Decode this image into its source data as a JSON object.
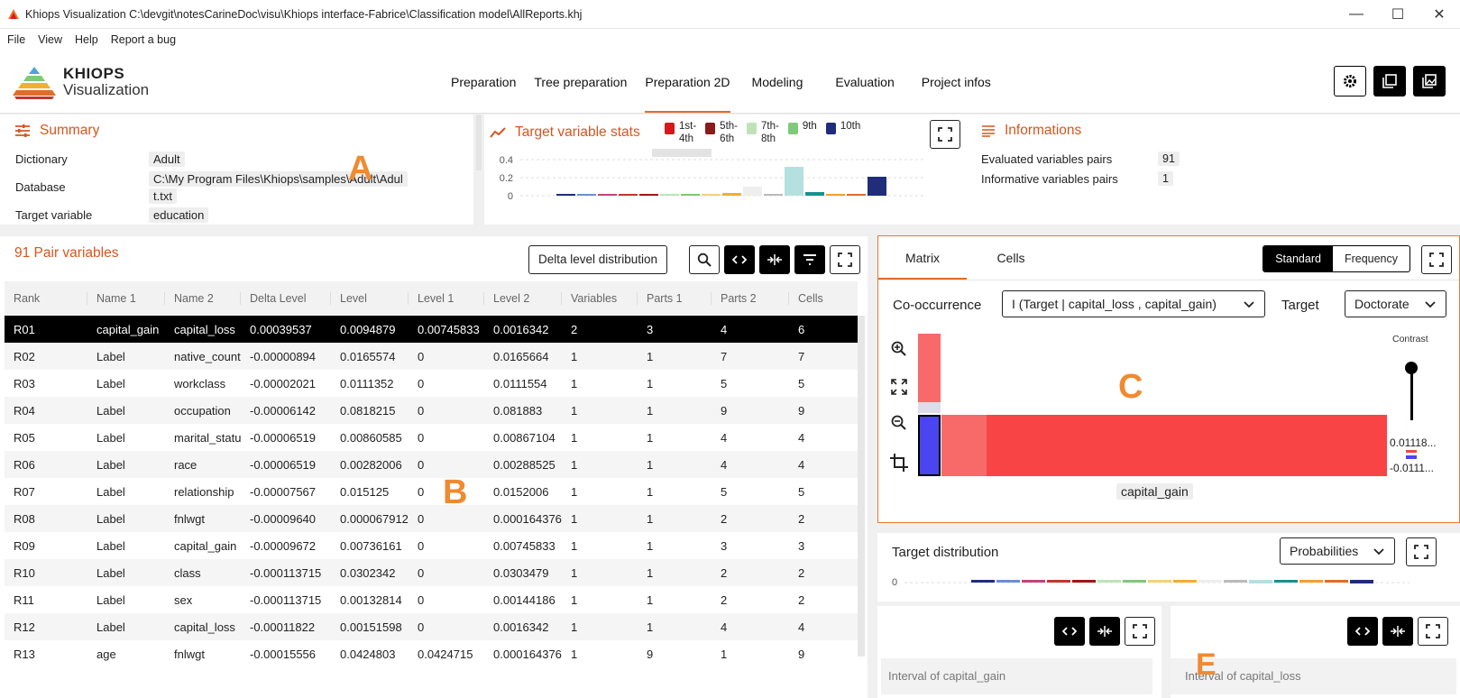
{
  "window": {
    "title": "Khiops Visualization C:\\devgit\\notesCarineDoc\\visu\\Khiops interface-Fabrice\\Classification model\\AllReports.khj",
    "minimize": "—",
    "maximize": "☐",
    "close": "✕"
  },
  "menu": {
    "file": "File",
    "view": "View",
    "help": "Help",
    "report_bug": "Report a bug"
  },
  "logo": {
    "line1": "KHIOPS",
    "line2": "Visualization"
  },
  "nav": [
    "Preparation",
    "Tree preparation",
    "Preparation 2D",
    "Modeling",
    "Evaluation",
    "Project infos"
  ],
  "nav_active": "Preparation 2D",
  "summary": {
    "title": "Summary",
    "rows": [
      {
        "label": "Dictionary",
        "value": "Adult"
      },
      {
        "label": "Database",
        "value": "C:\\My Program Files\\Khiops\\samples\\Adult\\Adul",
        "value2": "t.txt"
      },
      {
        "label": "Target variable",
        "value": "education"
      }
    ]
  },
  "markers": {
    "a": "A",
    "b": "B",
    "c": "C",
    "e": "E"
  },
  "target_stats": {
    "title": "Target variable stats",
    "legend": [
      {
        "line1": "1st-",
        "line2": "4th",
        "color": "#d11a1a"
      },
      {
        "line1": "5th-",
        "line2": "6th",
        "color": "#8b1a1a"
      },
      {
        "line1": "7th-",
        "line2": "8th",
        "color": "#bfe3b8"
      },
      {
        "line1": "9th",
        "line2": "",
        "color": "#7fc97a"
      },
      {
        "line1": "10th",
        "line2": "",
        "color": "#1f2d7a"
      }
    ],
    "y_ticks": [
      "0.4",
      "0.2",
      "0"
    ],
    "bars": [
      {
        "v": 0.01,
        "c": "#1f2d7a"
      },
      {
        "v": 0.015,
        "c": "#6b8fd6"
      },
      {
        "v": 0.012,
        "c": "#c2447a"
      },
      {
        "v": 0.013,
        "c": "#c0392b"
      },
      {
        "v": 0.012,
        "c": "#a31515"
      },
      {
        "v": 0.016,
        "c": "#bfe3b8"
      },
      {
        "v": 0.017,
        "c": "#7fc97a"
      },
      {
        "v": 0.02,
        "c": "#f3d27a"
      },
      {
        "v": 0.03,
        "c": "#f0b030"
      },
      {
        "v": 0.1,
        "c": "#eeeeee"
      },
      {
        "v": 0.02,
        "c": "#bbbbbb"
      },
      {
        "v": 0.32,
        "c": "#b5e0e0"
      },
      {
        "v": 0.04,
        "c": "#1a8f8f"
      },
      {
        "v": 0.02,
        "c": "#f0a030"
      },
      {
        "v": 0.015,
        "c": "#e06d2b"
      },
      {
        "v": 0.21,
        "c": "#1f2d7a"
      }
    ]
  },
  "informations": {
    "title": "Informations",
    "rows": [
      {
        "label": "Evaluated variables pairs",
        "value": "91"
      },
      {
        "label": "Informative variables pairs",
        "value": "1"
      }
    ]
  },
  "pairs": {
    "title": "91 Pair variables",
    "delta_button": "Delta level distribution",
    "columns": [
      "Rank",
      "Name 1",
      "Name 2",
      "Delta Level",
      "Level",
      "Level 1",
      "Level 2",
      "Variables",
      "Parts 1",
      "Parts 2",
      "Cells"
    ],
    "rows": [
      [
        "R01",
        "capital_gain",
        "capital_loss",
        "0.00039537",
        "0.0094879",
        "0.00745833",
        "0.0016342",
        "2",
        "3",
        "4",
        "6"
      ],
      [
        "R02",
        "Label",
        "native_country",
        "-0.00000894",
        "0.0165574",
        "0",
        "0.0165664",
        "1",
        "1",
        "7",
        "7"
      ],
      [
        "R03",
        "Label",
        "workclass",
        "-0.00002021",
        "0.0111352",
        "0",
        "0.0111554",
        "1",
        "1",
        "5",
        "5"
      ],
      [
        "R04",
        "Label",
        "occupation",
        "-0.00006142",
        "0.0818215",
        "0",
        "0.081883",
        "1",
        "1",
        "9",
        "9"
      ],
      [
        "R05",
        "Label",
        "marital_status",
        "-0.00006519",
        "0.00860585",
        "0",
        "0.00867104",
        "1",
        "1",
        "4",
        "4"
      ],
      [
        "R06",
        "Label",
        "race",
        "-0.00006519",
        "0.00282006",
        "0",
        "0.00288525",
        "1",
        "1",
        "4",
        "4"
      ],
      [
        "R07",
        "Label",
        "relationship",
        "-0.00007567",
        "0.015125",
        "0",
        "0.0152006",
        "1",
        "1",
        "5",
        "5"
      ],
      [
        "R08",
        "Label",
        "fnlwgt",
        "-0.00009640",
        "0.000067912",
        "0",
        "0.000164376",
        "1",
        "1",
        "2",
        "2"
      ],
      [
        "R09",
        "Label",
        "capital_gain",
        "-0.00009672",
        "0.00736161",
        "0",
        "0.00745833",
        "1",
        "1",
        "3",
        "3"
      ],
      [
        "R10",
        "Label",
        "class",
        "-0.000113715",
        "0.0302342",
        "0",
        "0.0303479",
        "1",
        "1",
        "2",
        "2"
      ],
      [
        "R11",
        "Label",
        "sex",
        "-0.000113715",
        "0.00132814",
        "0",
        "0.00144186",
        "1",
        "1",
        "2",
        "2"
      ],
      [
        "R12",
        "Label",
        "capital_loss",
        "-0.00011822",
        "0.00151598",
        "0",
        "0.0016342",
        "1",
        "1",
        "4",
        "4"
      ],
      [
        "R13",
        "age",
        "fnlwgt",
        "-0.00015556",
        "0.0424803",
        "0.0424715",
        "0.000164376",
        "1",
        "9",
        "1",
        "9"
      ]
    ]
  },
  "matrix": {
    "tabs": [
      "Matrix",
      "Cells"
    ],
    "mode_standard": "Standard",
    "mode_frequency": "Frequency",
    "cooccurrence_label": "Co-occurrence",
    "cooccurrence_value": "I (Target | capital_loss , capital_gain)",
    "target_label": "Target",
    "target_value": "Doctorate",
    "contrast_label": "Contrast",
    "legend_max": "0.01118...",
    "legend_min": "-0.0111...",
    "x_axis_label": "capital_gain"
  },
  "target_distribution": {
    "title": "Target distribution",
    "select": "Probabilities",
    "y_tick": "0"
  },
  "intervals": {
    "left": "Interval of capital_gain",
    "right": "Interval of capital_loss"
  }
}
